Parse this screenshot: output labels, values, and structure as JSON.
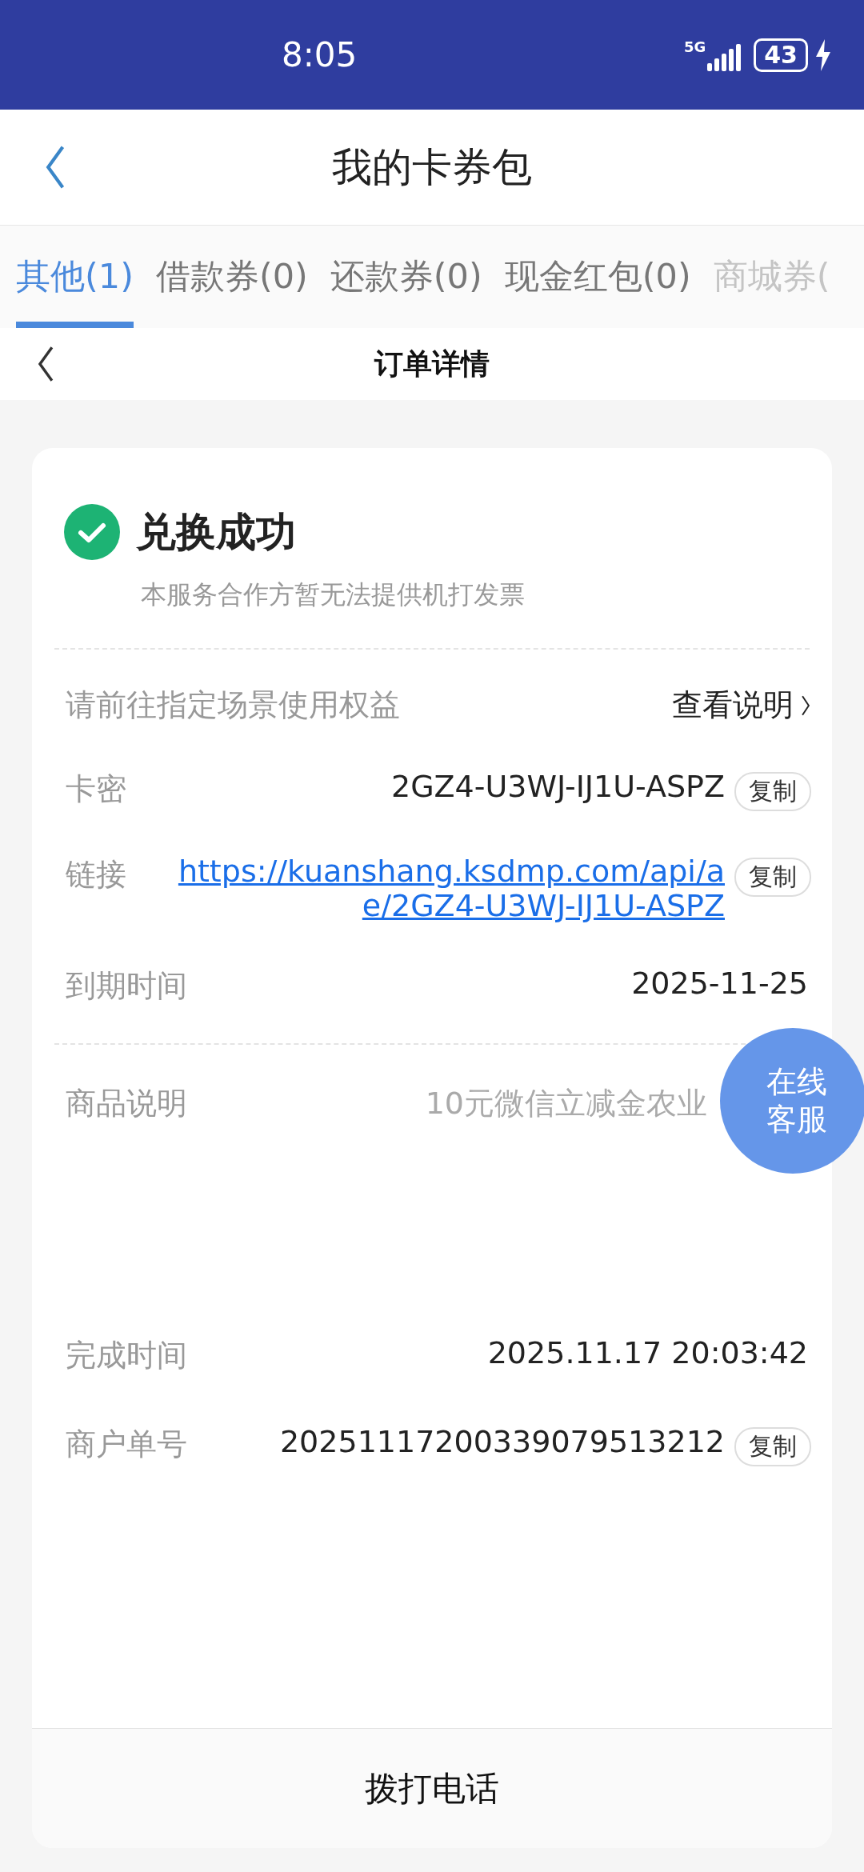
{
  "status_bar": {
    "time": "8:05",
    "network": "5G",
    "battery": "43",
    "charging": true
  },
  "header": {
    "title": "我的卡券包"
  },
  "tabs": [
    {
      "label": "其他(1)",
      "selected": true
    },
    {
      "label": "借款券(0)",
      "selected": false
    },
    {
      "label": "还款券(0)",
      "selected": false
    },
    {
      "label": "现金红包(0)",
      "selected": false
    },
    {
      "label": "商城券(",
      "selected": false
    }
  ],
  "subheader": {
    "title": "订单详情"
  },
  "result": {
    "title": "兑换成功",
    "subtitle": "本服务合作方暂无法提供机打发票"
  },
  "sections": [
    {
      "rows": [
        {
          "kind": "action",
          "label": "请前往指定场景使用权益",
          "value": "查看说明"
        },
        {
          "kind": "field",
          "label": "卡密",
          "value": "2GZ4-U3WJ-IJ1U-ASPZ",
          "copy": "复制"
        },
        {
          "kind": "link",
          "label": "链接",
          "lines": [
            "https://kuanshang.ksdmp.com/api/a",
            "e/2GZ4-U3WJ-IJ1U-ASPZ"
          ],
          "copy": "复制"
        },
        {
          "kind": "field",
          "label": "到期时间",
          "value": "2025-11-25"
        }
      ]
    },
    {
      "rows": [
        {
          "kind": "muted",
          "label": "商品说明",
          "value": "10元微信立减金农业"
        }
      ]
    },
    {
      "rows": [
        {
          "kind": "field",
          "label": "完成时间",
          "value": "2025.11.17 20:03:42"
        },
        {
          "kind": "field",
          "label": "商户单号",
          "value": "20251117200339079513212",
          "copy": "复制"
        }
      ]
    }
  ],
  "float_button": {
    "lines": [
      "在线",
      "客服"
    ]
  },
  "footer": {
    "button": "拨打电话"
  }
}
